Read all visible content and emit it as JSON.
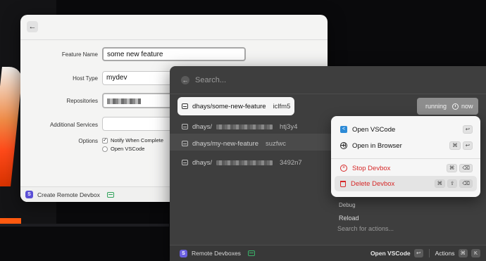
{
  "create_window": {
    "form": {
      "feature_name_label": "Feature Name",
      "feature_name_value": "some new feature",
      "host_type_label": "Host Type",
      "host_type_value": "mydev",
      "repositories_label": "Repositories",
      "additional_services_label": "Additional Services",
      "options_label": "Options",
      "notify_label": "Notify When Complete",
      "notify_checked": "✓",
      "open_vscode_label": "Open VSCode"
    },
    "footer": {
      "s_icon": "S",
      "label": "Create Remote Devbox"
    }
  },
  "remote_window": {
    "search_placeholder": "Search...",
    "rows": [
      {
        "name": "dhays/some-new-feature",
        "hash": "iclfm5"
      },
      {
        "name": "dhays/",
        "hash": "htj3y4"
      },
      {
        "name": "dhays/my-new-feature",
        "hash": "suzfwc"
      },
      {
        "name": "dhays/",
        "hash": "3492n7"
      }
    ],
    "status": {
      "state": "running",
      "time": "now"
    },
    "debug_title": "Debug",
    "reload_label": "Reload",
    "actions_search_placeholder": "Search for actions...",
    "footer": {
      "s_icon": "S",
      "label": "Remote Devboxes",
      "primary_action": "Open VSCode",
      "primary_key": "↩",
      "actions_label": "Actions",
      "actions_keys": [
        "⌘",
        "K"
      ]
    }
  },
  "action_menu": {
    "items": [
      {
        "label": "Open VSCode",
        "keys": [
          "↩"
        ]
      },
      {
        "label": "Open in Browser",
        "keys": [
          "⌘",
          "↩"
        ]
      },
      {
        "label": "Stop Devbox",
        "keys": [
          "⌘",
          "⌫"
        ]
      },
      {
        "label": "Delete Devbox",
        "keys": [
          "⌘",
          "⇧",
          "⌫"
        ]
      }
    ]
  },
  "colors": {
    "accent_purple": "#5b4fd6",
    "devbox_green": "#2fa35a",
    "danger_red": "#d62828",
    "vscode_blue": "#2c8ad6"
  }
}
